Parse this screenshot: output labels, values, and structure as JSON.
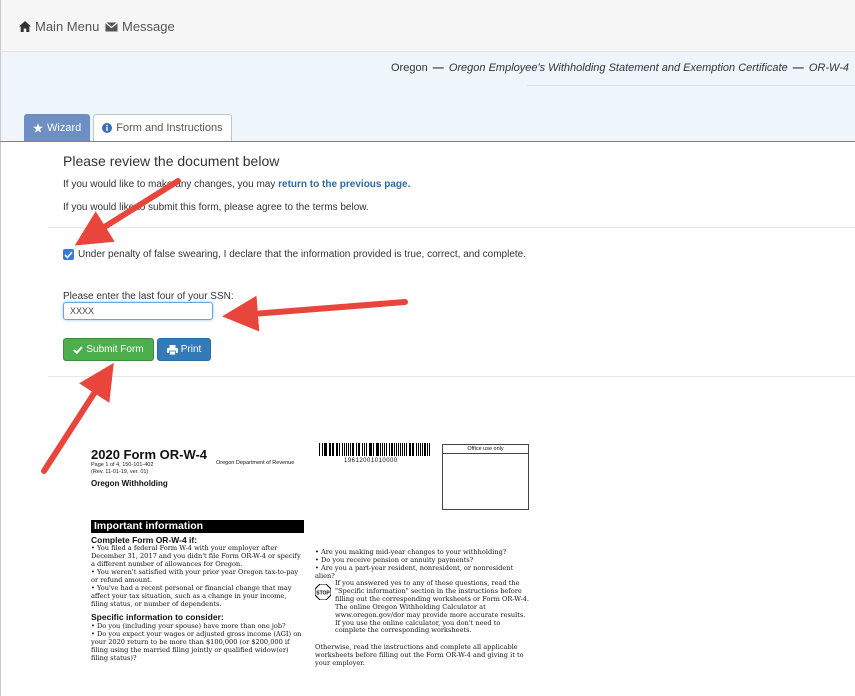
{
  "topbar": {
    "main_menu": "Main Menu",
    "message": "Message"
  },
  "breadcrumb": {
    "state": "Oregon",
    "form_title": "Oregon Employee's Withholding Statement and Exemption Certificate",
    "form_code": "OR-W-4"
  },
  "tabs": {
    "wizard": "Wizard",
    "form_and_instructions": "Form and Instructions"
  },
  "review": {
    "title": "Please review the document below",
    "change_text": "If you would like to make any changes, you may ",
    "change_link": "return to the previous page.",
    "submit_text": "If you would like to submit this form, please agree to the terms below.",
    "declaration": "Under penalty of false swearing, I declare that the information provided is true, correct, and complete.",
    "declaration_checked": true,
    "ssn_label": "Please enter the last four of your SSN:",
    "ssn_value": "XXXX",
    "submit_button": "Submit Form",
    "print_button": "Print"
  },
  "document": {
    "title": "2020 Form OR-W-4",
    "page_info": "Page 1 of 4, 150-101-402",
    "rev_info": "(Rev. 11-01-19, ver. 01)",
    "department": "Oregon Department of Revenue",
    "subtitle": "Oregon Withholding",
    "barcode_number": "19612001010000",
    "office_use": "Office use only",
    "important_heading": "Important information",
    "complete_heading": "Complete Form OR-W-4 if:",
    "left_bullets": [
      "• You filed a federal Form W-4 with your employer after December 31, 2017 and you didn't file Form OR-W-4 or specify a different number of allowances for Oregon.",
      "• You weren't satisfied with your prior year Oregon tax-to-pay or refund amount.",
      "• You've had a recent personal or financial change that may affect your tax situation, such as a change in your income, filing status, or number of dependents."
    ],
    "specific_heading": "Specific information to consider:",
    "specific_bullets": [
      "• Do you (including your spouse) have more than one job?",
      "• Do you expect your wages or adjusted gross income (AGI) on your 2020 return to be more than $100,000 (or $200,000 if filing using the married filing jointly or qualified widow(er) filing status)?"
    ],
    "right_bullets": [
      "• Are you making mid-year changes to your withholding?",
      "• Do you receive pension or annuity payments?",
      "• Are you a part-year resident, nonresident, or nonresident alien?"
    ],
    "stop_label": "STOP",
    "stop_text": "If you answered yes to any of these questions, read the \"Specific information\" section in the instructions before filling out the corresponding worksheets or Form OR-W-4. The online Oregon Withholding Calculator at www.oregon.gov/dor may provide more accurate results. If you use the online calculator, you don't need to complete the corresponding worksheets.",
    "closing_text": "Otherwise, read the instructions and complete all applicable worksheets before filling out the Form OR-W-4 and giving it to your employer."
  },
  "colors": {
    "wizard_tab": "#6e8fc4",
    "submit_green": "#4cae4c",
    "print_blue": "#337ab7",
    "link_blue": "#2e6aa6",
    "annotation_arrow": "#e8453c"
  }
}
